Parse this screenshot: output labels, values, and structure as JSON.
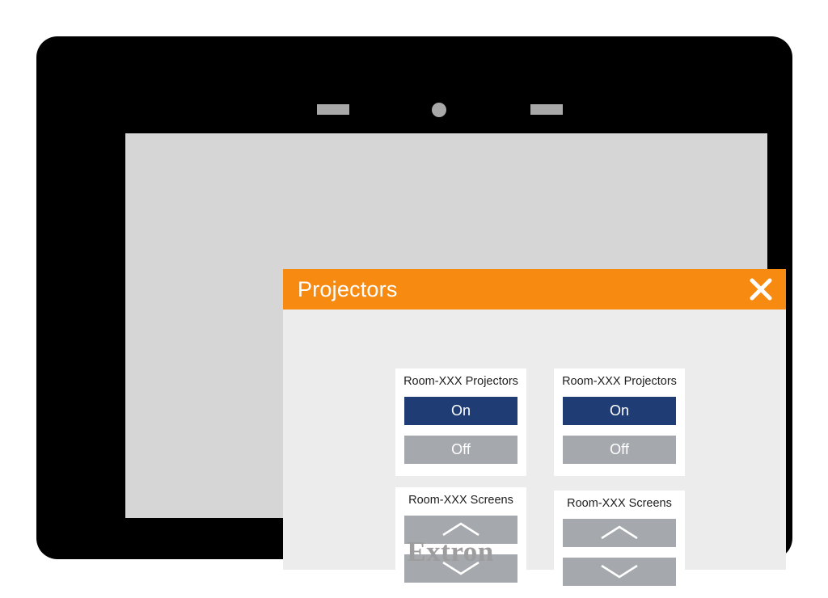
{
  "device": {
    "brand": "Extron",
    "bezel": {
      "left_grille": "speaker-grille",
      "sensor": "sensor-dot",
      "right_grille": "speaker-grille"
    }
  },
  "dialog": {
    "title": "Projectors",
    "close_icon": "close-x-icon",
    "accent_color": "#f78b12",
    "body_color": "#ececec",
    "cards": [
      {
        "id": "projectors-left",
        "title": "Room-XXX Projectors",
        "type": "power",
        "buttons": [
          {
            "label": "On",
            "state": "active",
            "color": "#1f3c74"
          },
          {
            "label": "Off",
            "state": "inactive",
            "color": "#a5a8ad"
          }
        ]
      },
      {
        "id": "projectors-right",
        "title": "Room-XXX Projectors",
        "type": "power",
        "buttons": [
          {
            "label": "On",
            "state": "active",
            "color": "#1f3c74"
          },
          {
            "label": "Off",
            "state": "inactive",
            "color": "#a5a8ad"
          }
        ]
      },
      {
        "id": "screens-left",
        "title": "Room-XXX Screens",
        "type": "screen",
        "buttons": [
          {
            "icon": "chevron-up-icon",
            "color": "#a5a8ad"
          },
          {
            "icon": "chevron-down-icon",
            "color": "#a5a8ad"
          }
        ]
      },
      {
        "id": "screens-right",
        "title": "Room-XXX Screens",
        "type": "screen",
        "buttons": [
          {
            "icon": "chevron-up-icon",
            "color": "#a5a8ad"
          },
          {
            "icon": "chevron-down-icon",
            "color": "#a5a8ad"
          }
        ]
      }
    ]
  }
}
